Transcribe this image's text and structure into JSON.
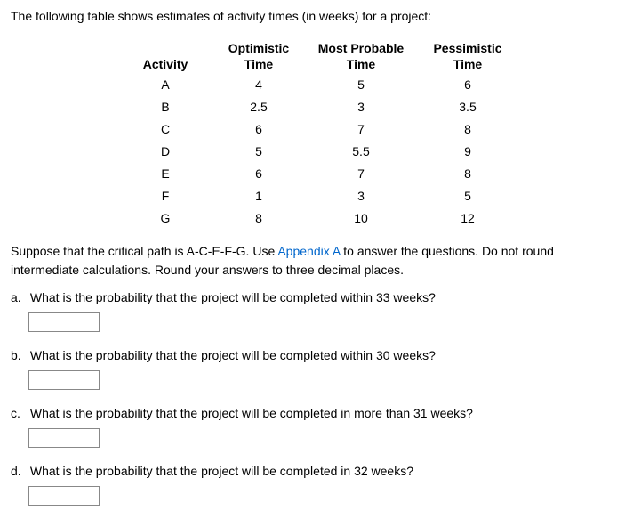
{
  "intro": "The following table shows estimates of activity times (in weeks) for a project:",
  "headers": {
    "activity": "Activity",
    "optimistic_top": "Optimistic",
    "optimistic_sub": "Time",
    "mostprob_top": "Most Probable",
    "mostprob_sub": "Time",
    "pessimistic_top": "Pessimistic",
    "pessimistic_sub": "Time"
  },
  "rows": [
    {
      "activity": "A",
      "opt": "4",
      "mp": "5",
      "pess": "6"
    },
    {
      "activity": "B",
      "opt": "2.5",
      "mp": "3",
      "pess": "3.5"
    },
    {
      "activity": "C",
      "opt": "6",
      "mp": "7",
      "pess": "8"
    },
    {
      "activity": "D",
      "opt": "5",
      "mp": "5.5",
      "pess": "9"
    },
    {
      "activity": "E",
      "opt": "6",
      "mp": "7",
      "pess": "8"
    },
    {
      "activity": "F",
      "opt": "1",
      "mp": "3",
      "pess": "5"
    },
    {
      "activity": "G",
      "opt": "8",
      "mp": "10",
      "pess": "12"
    }
  ],
  "instr_pre": "Suppose that the critical path is A-C-E-F-G. Use ",
  "instr_link": "Appendix A",
  "instr_post": " to answer the questions. Do not round intermediate calculations. Round your answers to three decimal places.",
  "questions": [
    {
      "marker": "a.",
      "text": "What is the probability that the project will be completed within 33 weeks?"
    },
    {
      "marker": "b.",
      "text": "What is the probability that the project will be completed within 30 weeks?"
    },
    {
      "marker": "c.",
      "text": "What is the probability that the project will be completed in more than 31 weeks?"
    },
    {
      "marker": "d.",
      "text": "What is the probability that the project will be completed in 32 weeks?"
    }
  ]
}
